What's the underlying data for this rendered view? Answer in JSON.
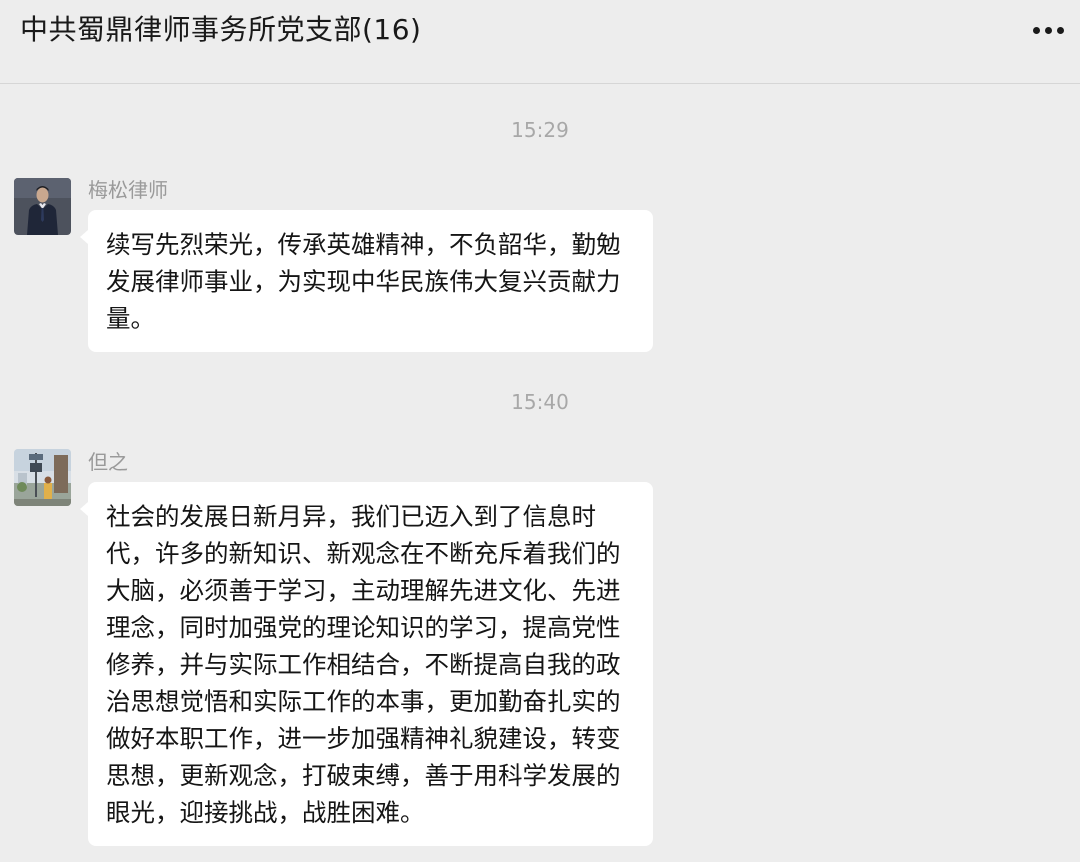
{
  "header": {
    "title": "中共蜀鼎律师事务所党支部(16)",
    "more_icon": "more-dots-icon"
  },
  "messages": [
    {
      "time": "15:29",
      "sender": "梅松律师",
      "avatar_icon": "person-in-suit-avatar",
      "text": "续写先烈荣光，传承英雄精神，不负韶华，勤勉发展律师事业，为实现中华民族伟大复兴贡献力量。"
    },
    {
      "time": "15:40",
      "sender": "但之",
      "avatar_icon": "street-photo-avatar",
      "text": "社会的发展日新月异，我们已迈入到了信息时代，许多的新知识、新观念在不断充斥着我们的大脑，必须善于学习，主动理解先进文化、先进理念，同时加强党的理论知识的学习，提高党性修养，并与实际工作相结合，不断提高自我的政治思想觉悟和实际工作的本事，更加勤奋扎实的做好本职工作，进一步加强精神礼貌建设，转变思想，更新观念，打破束缚，善于用科学发展的眼光，迎接挑战，战胜困难。"
    }
  ],
  "colors": {
    "background": "#ededed",
    "bubble": "#ffffff",
    "timestamp": "#a8a8a8",
    "sender": "#9a9a9a"
  }
}
